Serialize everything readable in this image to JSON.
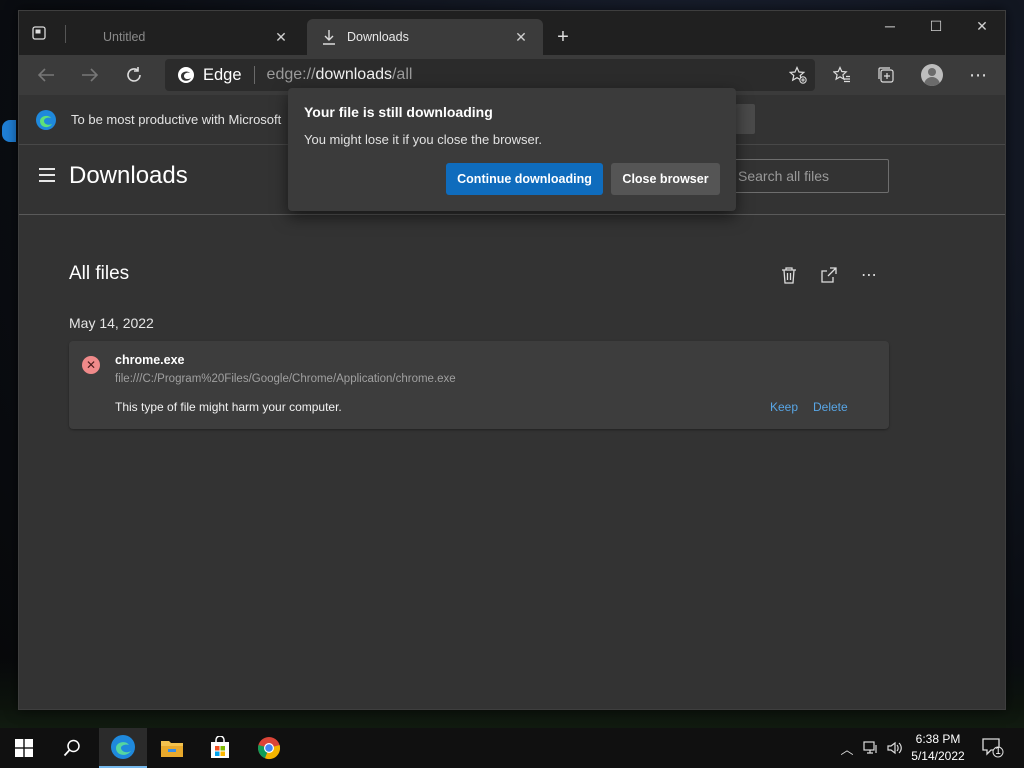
{
  "window": {
    "tabs": [
      {
        "title": "Untitled",
        "active": false
      },
      {
        "title": "Downloads",
        "active": true
      }
    ],
    "new_tab_label": "+"
  },
  "address_bar": {
    "brand": "Edge",
    "scheme": "edge://",
    "host": "downloads",
    "path": "/all"
  },
  "infobar": {
    "message": "To be most productive with Microsoft"
  },
  "page": {
    "title": "Downloads",
    "search_placeholder": "Search all files",
    "section_title": "All files",
    "date_heading": "May 14, 2022",
    "downloads": [
      {
        "filename": "chrome.exe",
        "path": "file:///C:/Program%20Files/Google/Chrome/Application/chrome.exe",
        "warning": "This type of file might harm your computer.",
        "actions": [
          "Keep",
          "Delete"
        ],
        "status_icon": "error-x-icon"
      }
    ]
  },
  "dialog": {
    "title": "Your file is still downloading",
    "message": "You might lose it if you close the browser.",
    "primary_button": "Continue downloading",
    "secondary_button": "Close browser"
  },
  "taskbar": {
    "time": "6:38 PM",
    "date": "5/14/2022",
    "notification_count": "1",
    "pinned_apps": [
      "edge-icon",
      "file-explorer-icon",
      "microsoft-store-icon",
      "chrome-icon"
    ]
  },
  "colors": {
    "accent": "#0f6cbd",
    "link": "#58a6e6",
    "error": "#f08a8a"
  }
}
